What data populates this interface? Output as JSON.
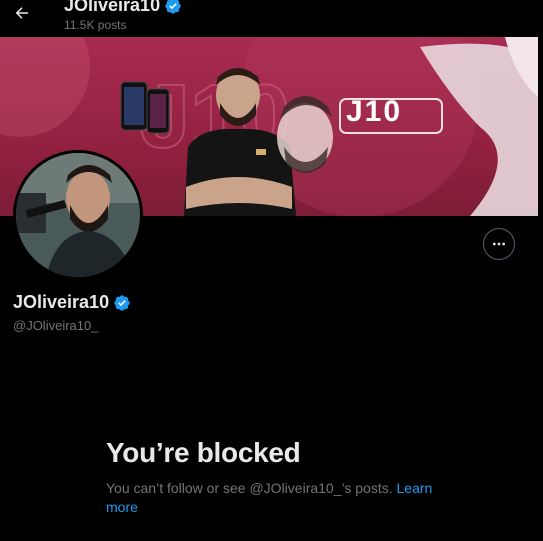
{
  "header": {
    "name": "JOliveira10",
    "posts": "11.5K posts",
    "back_icon": "arrow-left-icon"
  },
  "banner": {
    "logo_text": "J10",
    "background_color": "#a82b52"
  },
  "profile": {
    "display_name": "JOliveira10",
    "handle": "@JOliveira10_",
    "verified_color": "#1d9bf0",
    "more_icon": "more-horizontal-icon"
  },
  "blocked": {
    "title": "You’re blocked",
    "desc_prefix": "You can’t follow or see ",
    "desc_handle": "@JOliveira10_",
    "desc_suffix": "’s posts. ",
    "learn_more": "Learn more"
  },
  "colors": {
    "accent": "#1d9bf0",
    "muted": "#71767b",
    "text": "#e7e9ea"
  }
}
